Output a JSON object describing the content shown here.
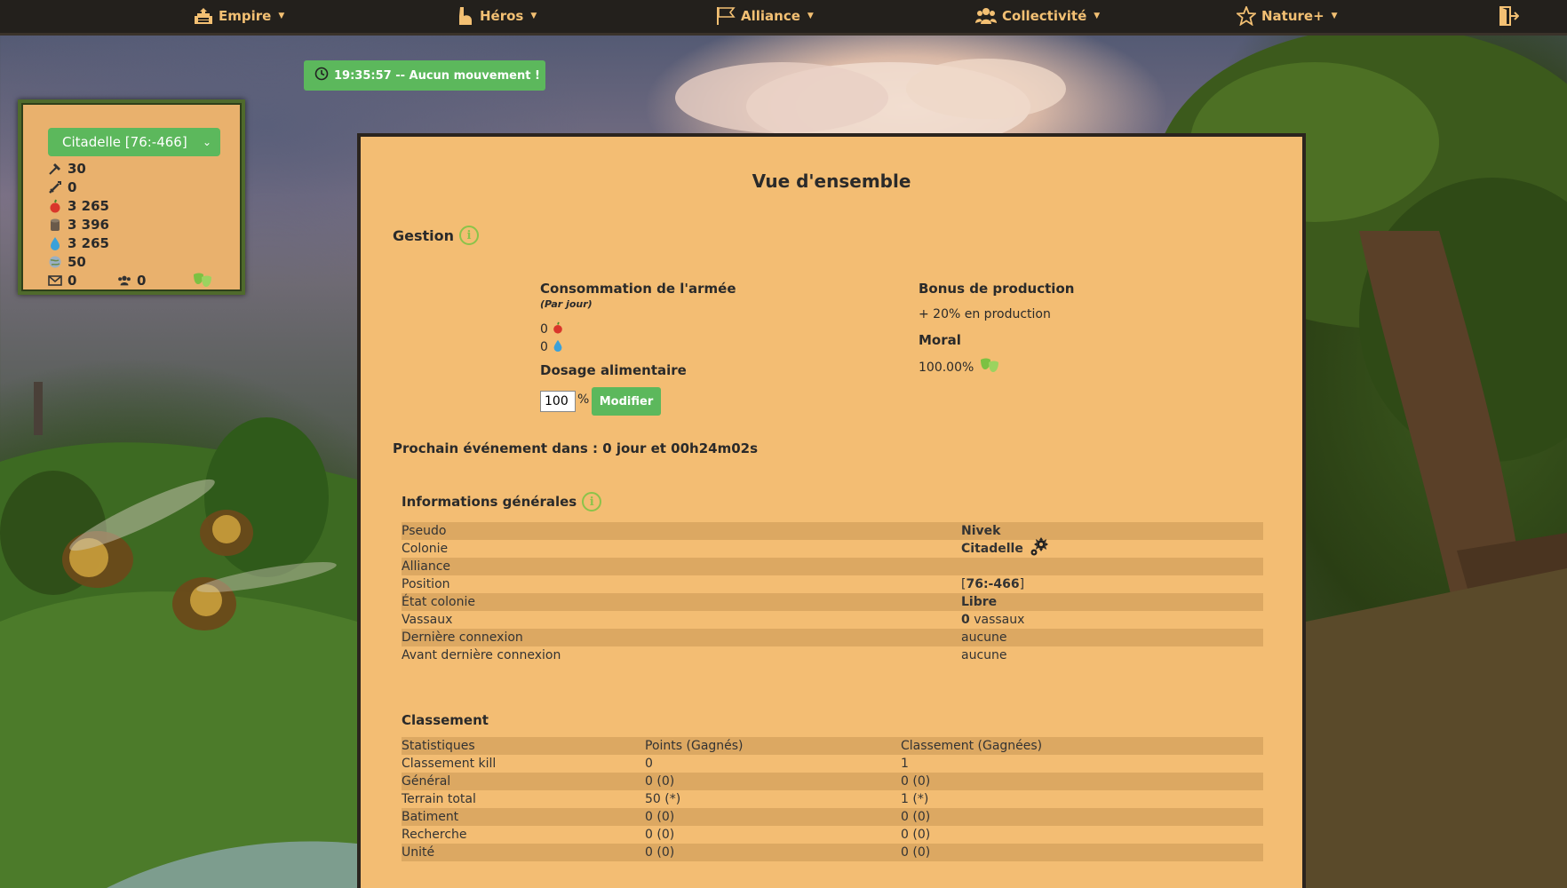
{
  "nav": {
    "items": [
      {
        "label": "Empire",
        "icon": "empire-icon"
      },
      {
        "label": "Héros",
        "icon": "hero-arm-icon"
      },
      {
        "label": "Alliance",
        "icon": "flag-icon"
      },
      {
        "label": "Collectivité",
        "icon": "group-icon"
      },
      {
        "label": "Nature+",
        "icon": "star-icon"
      }
    ],
    "logout_icon": "logout-icon"
  },
  "timer": {
    "text": "19:35:57 -- Aucun mouvement !"
  },
  "resources": {
    "colony_select": "Citadelle [76:-466]",
    "workers": "30",
    "soldiers": "0",
    "food": "3 265",
    "wood": "3 396",
    "water": "3 265",
    "land": "50",
    "messages": "0",
    "members": "0"
  },
  "main": {
    "title": "Vue d'ensemble",
    "gestion": "Gestion",
    "consumption_title": "Consommation de l'armée",
    "consumption_sub": "(Par jour)",
    "consumption_food": "0",
    "consumption_water": "0",
    "dosage_title": "Dosage alimentaire",
    "dosage_value": "100",
    "dosage_unit": "%",
    "modify_label": "Modifier",
    "bonus_title": "Bonus de production",
    "bonus_text": "+ 20% en production",
    "moral_title": "Moral",
    "moral_value": "100.00%",
    "next_event": "Prochain événement dans : 0 jour et 00h24m02s",
    "info_title": "Informations générales",
    "info_rows": [
      {
        "label": "Pseudo",
        "value": "Nivek"
      },
      {
        "label": "Colonie",
        "value": "Citadelle"
      },
      {
        "label": "Alliance",
        "value": ""
      },
      {
        "label": "Position",
        "value_pre": "[",
        "value": "76:-466",
        "value_post": "]"
      },
      {
        "label": "État colonie",
        "value": "Libre"
      },
      {
        "label": "Vassaux",
        "value": "0",
        "value_post": " vassaux"
      },
      {
        "label": "Dernière connexion",
        "value": "aucune"
      },
      {
        "label": "Avant dernière connexion",
        "value": "aucune"
      }
    ],
    "ranking_title": "Classement",
    "ranking_headers": [
      "Statistiques",
      "Points (Gagnés)",
      "Classement (Gagnées)"
    ],
    "ranking_rows": [
      [
        "Classement kill",
        "0",
        "1"
      ],
      [
        "Général",
        "0 (0)",
        "0 (0)"
      ],
      [
        "Terrain total",
        "50 (*)",
        "1 (*)"
      ],
      [
        "Batiment",
        "0 (0)",
        "0 (0)"
      ],
      [
        "Recherche",
        "0 (0)",
        "0 (0)"
      ],
      [
        "Unité",
        "0 (0)",
        "0 (0)"
      ]
    ]
  }
}
